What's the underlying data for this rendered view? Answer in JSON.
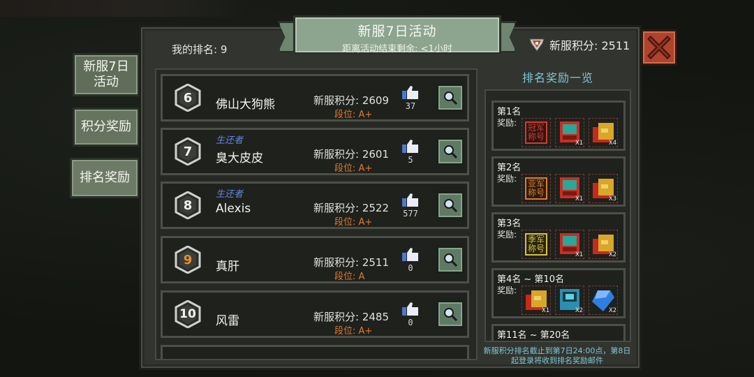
{
  "side_tabs": [
    {
      "label": "新服7日\n活动"
    },
    {
      "label": "积分奖励"
    },
    {
      "label": "排名奖励"
    }
  ],
  "header": {
    "title": "新服7日活动",
    "subtitle": "距离活动结束剩余: <1小时",
    "my_rank": "我的排名: 9",
    "server_points": "新服积分: 2511"
  },
  "ranking": [
    {
      "rank": "6",
      "name": "佛山大狗熊",
      "tag": "",
      "points": "新服积分: 2609",
      "tier": "段位: A+",
      "likes": "37"
    },
    {
      "rank": "7",
      "name": "臭大皮皮",
      "tag": "生还者",
      "points": "新服积分: 2601",
      "tier": "段位: A+",
      "likes": "5"
    },
    {
      "rank": "8",
      "name": "Alexis",
      "tag": "生还者",
      "points": "新服积分: 2522",
      "tier": "段位: A+",
      "likes": "577"
    },
    {
      "rank": "9",
      "name": "真肝",
      "tag": "",
      "points": "新服积分: 2511",
      "tier": "段位: A",
      "likes": "0"
    },
    {
      "rank": "10",
      "name": "风雷",
      "tag": "",
      "points": "新服积分: 2485",
      "tier": "段位: A+",
      "likes": "0"
    }
  ],
  "rewards": {
    "title": "排名奖励一览",
    "reward_label": "奖励:",
    "tiers": [
      {
        "title": "第1名",
        "items": [
          {
            "kind": "title",
            "text": "冠军\n称号",
            "color": "#d63a2c"
          },
          {
            "kind": "device",
            "mult": "X1"
          },
          {
            "kind": "chest",
            "mult": "X4"
          }
        ]
      },
      {
        "title": "第2名",
        "items": [
          {
            "kind": "title",
            "text": "亚军\n称号",
            "color": "#e07b2c"
          },
          {
            "kind": "device",
            "mult": "X1"
          },
          {
            "kind": "chest",
            "mult": "X3"
          }
        ]
      },
      {
        "title": "第3名",
        "items": [
          {
            "kind": "title",
            "text": "季军\n称号",
            "color": "#d8c23a"
          },
          {
            "kind": "device",
            "mult": "X1"
          },
          {
            "kind": "chest",
            "mult": "X2"
          }
        ]
      },
      {
        "title": "第4名 ~ 第10名",
        "items": [
          {
            "kind": "chest",
            "mult": "X1"
          },
          {
            "kind": "device-blue",
            "mult": "X2"
          },
          {
            "kind": "gem",
            "mult": "X2"
          }
        ]
      },
      {
        "title": "第11名 ~ 第20名",
        "items": []
      }
    ],
    "footnote": "新服积分排名截止到第7日24:00点，第8日起登录将收到排名奖励邮件"
  },
  "colors": {
    "accent_orange": "#e07b2c",
    "survivor_tag": "#5f86e0",
    "cyan_text": "#7fc6d6",
    "close_red": "#b0432c"
  }
}
